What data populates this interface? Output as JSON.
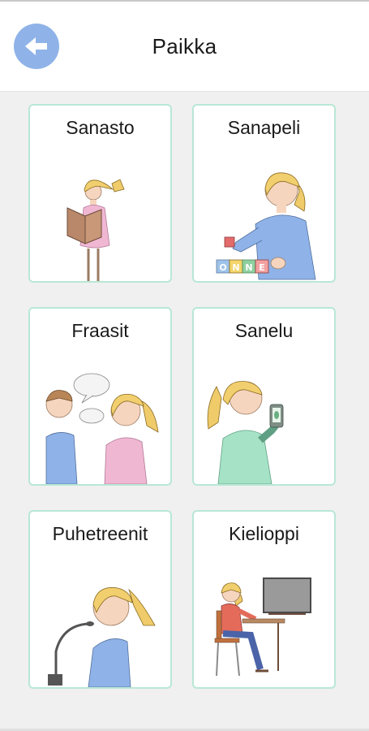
{
  "header": {
    "title": "Paikka",
    "back_icon": "arrow-left-icon"
  },
  "cards": [
    {
      "label": "Sanasto",
      "icon": "girl-reading-book-icon"
    },
    {
      "label": "Sanapeli",
      "icon": "girl-letter-blocks-icon",
      "blocks": [
        "O",
        "N",
        "N",
        "E"
      ]
    },
    {
      "label": "Fraasit",
      "icon": "boy-girl-talking-icon"
    },
    {
      "label": "Sanelu",
      "icon": "girl-phone-dictation-icon"
    },
    {
      "label": "Puhetreenit",
      "icon": "girl-microphone-icon"
    },
    {
      "label": "Kielioppi",
      "icon": "girl-at-desk-blackboard-icon"
    }
  ],
  "colors": {
    "accent": "#8fb3e8",
    "card_border": "#b9e7d6",
    "background": "#f0f0f0"
  }
}
